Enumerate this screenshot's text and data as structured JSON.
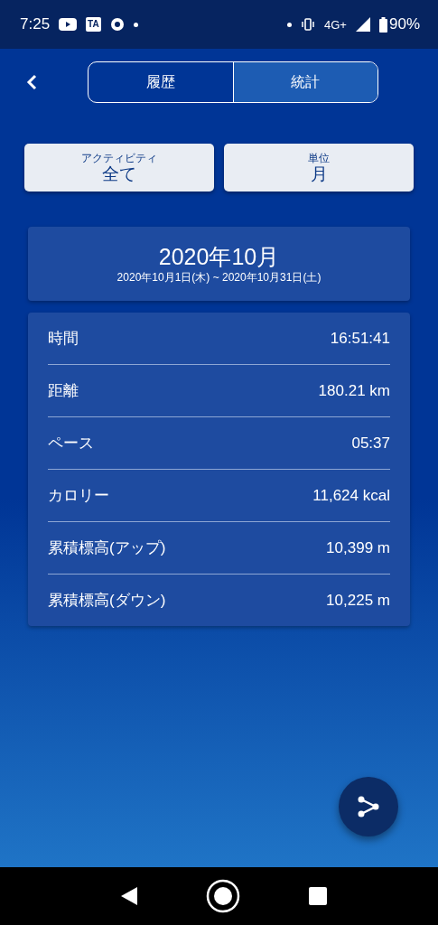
{
  "status_bar": {
    "time": "7:25",
    "app_badge": "TA",
    "network": "4G+",
    "battery": "90%"
  },
  "tabs": [
    {
      "label": "履歴",
      "selected": false
    },
    {
      "label": "統計",
      "selected": true
    }
  ],
  "filters": [
    {
      "caption": "アクティビティ",
      "value": "全て"
    },
    {
      "caption": "単位",
      "value": "月"
    }
  ],
  "period": {
    "title": "2020年10月",
    "range": "2020年10月1日(木) ~ 2020年10月31日(土)"
  },
  "stats": [
    {
      "label": "時間",
      "value": "16:51:41"
    },
    {
      "label": "距離",
      "value": "180.21 km"
    },
    {
      "label": "ペース",
      "value": "05:37"
    },
    {
      "label": "カロリー",
      "value": "11,624 kcal"
    },
    {
      "label": "累積標高(アップ)",
      "value": "10,399 m"
    },
    {
      "label": "累積標高(ダウン)",
      "value": "10,225 m"
    }
  ]
}
